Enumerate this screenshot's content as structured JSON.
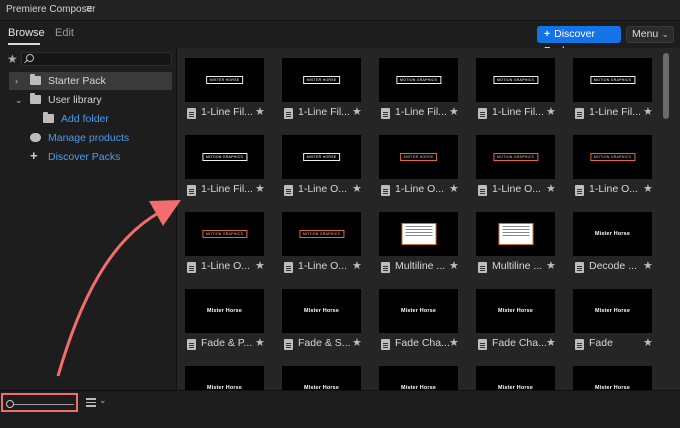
{
  "app": {
    "title": "Premiere Composer"
  },
  "tabs": {
    "browse": "Browse",
    "edit": "Edit"
  },
  "toolbar": {
    "discover_label": "Discover Packs",
    "menu_label": "Menu"
  },
  "sidebar": {
    "items": [
      {
        "label": "Starter Pack",
        "icon": "folder-icon"
      },
      {
        "label": "User library",
        "icon": "folder-icon"
      },
      {
        "label": "Add folder",
        "icon": "add-folder-icon"
      },
      {
        "label": "Manage products",
        "icon": "cloud-download-icon"
      },
      {
        "label": "Discover Packs",
        "icon": "plus-icon"
      }
    ]
  },
  "grid": {
    "tiles": [
      {
        "name": "1-Line Fil...",
        "thumb_text": "MISTER HORSE"
      },
      {
        "name": "1-Line Fil...",
        "thumb_text": "MISTER HORSE"
      },
      {
        "name": "1-Line Fil...",
        "thumb_text": "MOTION GRAPHICS"
      },
      {
        "name": "1-Line Fil...",
        "thumb_text": "MOTION GRAPHICS"
      },
      {
        "name": "1-Line Fil...",
        "thumb_text": "MOTION GRAPHICS"
      },
      {
        "name": "1-Line Fil...",
        "thumb_text": "MOTION GRAPHICS"
      },
      {
        "name": "1-Line O...",
        "thumb_text": "MISTER HORSE"
      },
      {
        "name": "1-Line O...",
        "thumb_text": "MISTER HORSE"
      },
      {
        "name": "1-Line O...",
        "thumb_text": "MOTION GRAPHICS"
      },
      {
        "name": "1-Line O...",
        "thumb_text": "MOTION GRAPHICS"
      },
      {
        "name": "1-Line O...",
        "thumb_text": "MOTION GRAPHICS"
      },
      {
        "name": "1-Line O...",
        "thumb_text": "MOTION GRAPHICS"
      },
      {
        "name": "Multiline ...",
        "thumb_text": ""
      },
      {
        "name": "Multiline ...",
        "thumb_text": ""
      },
      {
        "name": "Decode ...",
        "thumb_text": "Mister Horse"
      },
      {
        "name": "Fade & P...",
        "thumb_text": "Mister Horse"
      },
      {
        "name": "Fade & S...",
        "thumb_text": "Mister Horse"
      },
      {
        "name": "Fade Cha...",
        "thumb_text": "Mister Horse"
      },
      {
        "name": "Fade Cha...",
        "thumb_text": "Mister Horse"
      },
      {
        "name": "Fade",
        "thumb_text": "Mister Horse"
      },
      {
        "name": "",
        "thumb_text": "Mister Horse"
      },
      {
        "name": "",
        "thumb_text": "Mister Horse"
      },
      {
        "name": "",
        "thumb_text": "Mister Horse"
      },
      {
        "name": "",
        "thumb_text": "Mister Horse"
      },
      {
        "name": "",
        "thumb_text": "Mister Horse"
      }
    ]
  },
  "colors": {
    "accent": "#1473e6",
    "link": "#4a9cf0",
    "annotation": "#f26d6d"
  }
}
